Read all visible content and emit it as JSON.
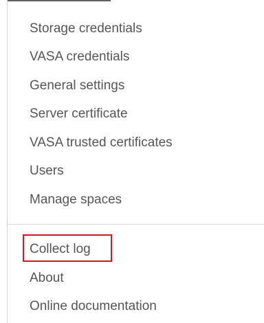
{
  "menu": {
    "group_1": [
      {
        "label": "Storage credentials"
      },
      {
        "label": "VASA credentials"
      },
      {
        "label": "General settings"
      },
      {
        "label": "Server certificate"
      },
      {
        "label": "VASA trusted certificates"
      },
      {
        "label": "Users"
      },
      {
        "label": "Manage spaces"
      }
    ],
    "group_2": [
      {
        "label": "Collect log",
        "highlighted": true
      },
      {
        "label": "About"
      },
      {
        "label": "Online documentation"
      }
    ]
  },
  "colors": {
    "text": "#555555",
    "highlight_border": "#e0101e",
    "divider": "#dcdcdc"
  }
}
